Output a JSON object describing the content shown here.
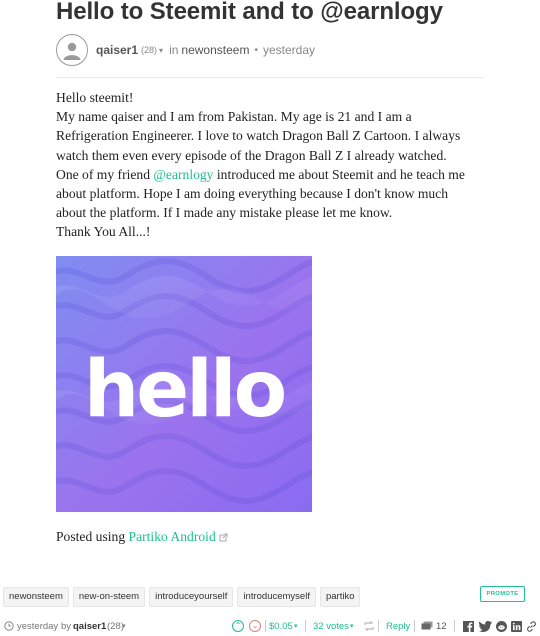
{
  "post": {
    "title": "Hello to Steemit and to @earnlogy",
    "author": "qaiser1",
    "reputation": "(28)",
    "in_word": "in",
    "community": "newonsteem",
    "time": "yesterday"
  },
  "body": {
    "line1": "Hello steemit!",
    "line2": "My name qaiser and I am from Pakistan. My age is 21 and I am a",
    "line3": "Refrigeration Engineerer. I love to watch Dragon Ball Z Cartoon. I always",
    "line4": "watch them even every episode of the Dragon Ball Z I already watched.",
    "line5_pre": "One of my friend ",
    "line5_link": "@earnlogy",
    "line5_post": " introduced me about Steemit and he teach me",
    "line6": "about platform. Hope I am doing everything because I don't know much",
    "line7": "about the platform. If I made any mistake please let me know.",
    "line8": "Thank You All...!",
    "image_text": "hello",
    "posted_using_label": "Posted using ",
    "posted_using_link": "Partiko Android"
  },
  "tags": [
    "newonsteem",
    "new-on-steem",
    "introduceyourself",
    "introducemyself",
    "partiko"
  ],
  "promote_label": "PROMOTE",
  "footer": {
    "time": "yesterday",
    "by_word": "by",
    "author": "qaiser1",
    "reputation": "(28)",
    "payout": "$0.05",
    "votes": "32 votes",
    "reply_label": "Reply",
    "comments": "12"
  },
  "colors": {
    "accent": "#1fbf8f",
    "image_gradient_start": "#7f8df2",
    "image_gradient_end": "#8a6bf0"
  },
  "icons": [
    "user-avatar-icon",
    "external-link-icon",
    "clock-icon",
    "upvote-icon",
    "downvote-icon",
    "resteem-icon",
    "comments-icon",
    "facebook-icon",
    "twitter-icon",
    "reddit-icon",
    "linkedin-icon",
    "link-icon"
  ]
}
